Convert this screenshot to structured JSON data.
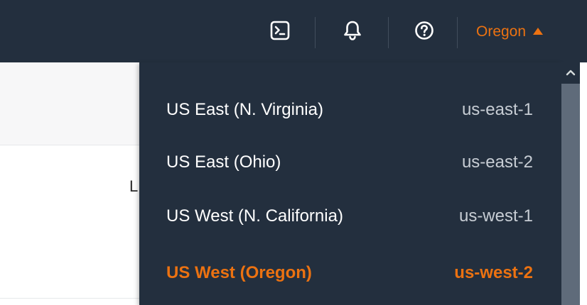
{
  "header": {
    "cloudshell_icon": "cloudshell-icon",
    "notifications_icon": "bell-icon",
    "help_icon": "help-icon",
    "region_button_label": "Oregon",
    "region_caret_icon": "caret-up-icon"
  },
  "page": {
    "fragment_text": "L"
  },
  "region_menu": {
    "items": [
      {
        "name": "US East (N. Virginia)",
        "code": "us-east-1",
        "selected": false
      },
      {
        "name": "US East (Ohio)",
        "code": "us-east-2",
        "selected": false
      },
      {
        "name": "US West (N. California)",
        "code": "us-west-1",
        "selected": false
      },
      {
        "name": "US West (Oregon)",
        "code": "us-west-2",
        "selected": true
      }
    ]
  },
  "scrollbar": {
    "up_icon": "chevron-up-icon"
  },
  "colors": {
    "nav_bg": "#232f3e",
    "accent": "#ec7211",
    "muted_text": "#c7cdd4",
    "scrollbar": "#5f6b7a"
  }
}
